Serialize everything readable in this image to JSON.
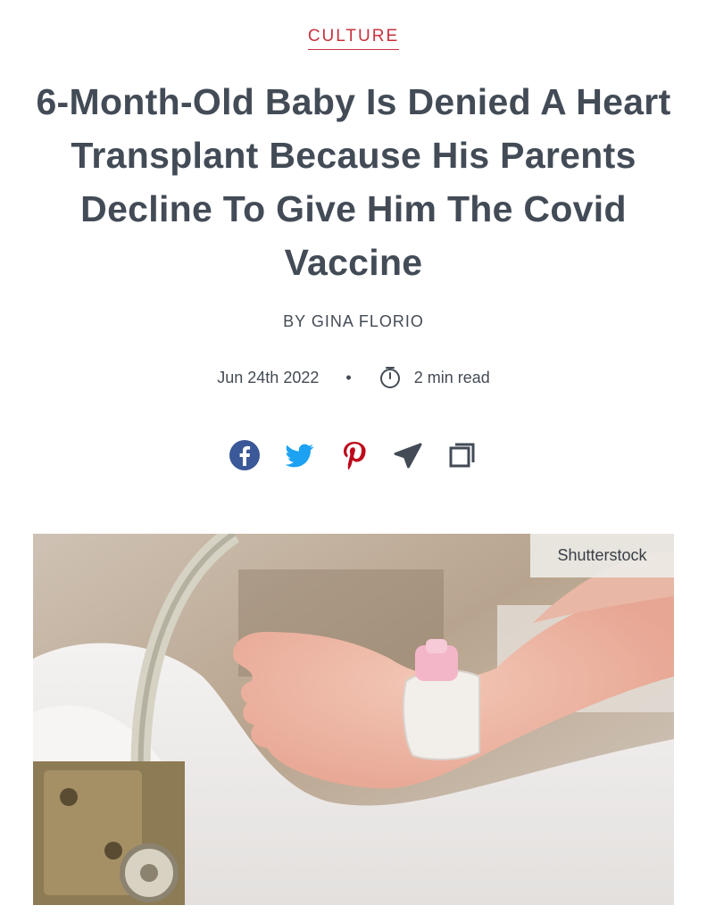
{
  "article": {
    "category": "CULTURE",
    "headline": "6-Month-Old Baby Is Denied A Heart Transplant Because His Parents Decline To Give Him The Covid Vaccine",
    "byline": "BY GINA FLORIO",
    "date": "Jun 24th 2022",
    "separator": "•",
    "read_time": "2 min read"
  },
  "share": {
    "icons": [
      "facebook-icon",
      "twitter-icon",
      "pinterest-icon",
      "telegram-icon",
      "copy-link-icon"
    ]
  },
  "hero_image": {
    "credit": "Shutterstock"
  },
  "colors": {
    "accent": "#c8323e",
    "headline": "#424b56",
    "facebook": "#3b5998",
    "twitter": "#1da1f2",
    "pinterest": "#bd081c",
    "icon_dark": "#424b56"
  }
}
